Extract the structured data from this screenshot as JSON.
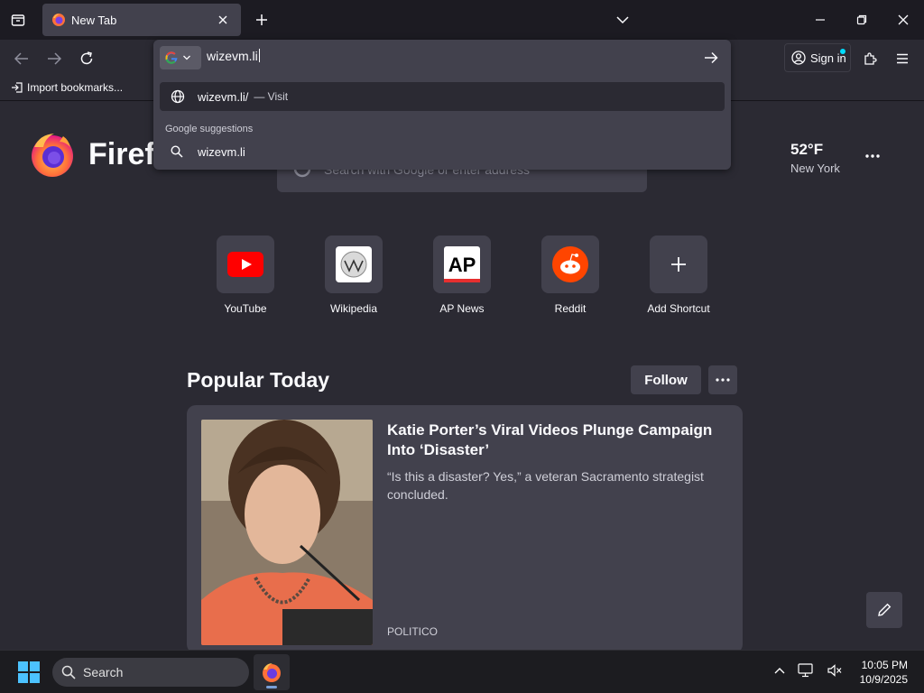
{
  "browser": {
    "tab_title": "New Tab",
    "bookmark_import_label": "Import bookmarks...",
    "sign_in_label": "Sign in"
  },
  "urlbar": {
    "typed_value": "wizevm.li",
    "result_visit_url": "wizevm.li/",
    "result_visit_action": "— Visit",
    "group_label": "Google suggestions",
    "suggestion": "wizevm.li"
  },
  "newtab": {
    "logo_text": "Firefox",
    "search_placeholder": "Search with Google or enter address",
    "weather": {
      "temp": "52°F",
      "city": "New York"
    },
    "shortcuts": [
      {
        "label": "YouTube",
        "icon": "youtube-icon"
      },
      {
        "label": "Wikipedia",
        "icon": "wikipedia-icon"
      },
      {
        "label": "AP News",
        "icon": "ap-news-icon"
      },
      {
        "label": "Reddit",
        "icon": "reddit-icon"
      },
      {
        "label": "Add Shortcut",
        "icon": "plus-icon"
      }
    ],
    "popular": {
      "title": "Popular Today",
      "follow_label": "Follow",
      "card": {
        "headline": "Katie Porter’s Viral Videos Plunge Campaign Into ‘Disaster’",
        "excerpt": "“Is this a disaster? Yes,” a veteran Sacramento strategist concluded.",
        "source": "POLITICO"
      }
    }
  },
  "taskbar": {
    "search_label": "Search",
    "time": "10:05 PM",
    "date": "10/9/2025"
  },
  "colors": {
    "background": "#2b2a33",
    "surface": "#42414d",
    "tabstrip": "#1c1b22",
    "accent": "#00ddff"
  }
}
